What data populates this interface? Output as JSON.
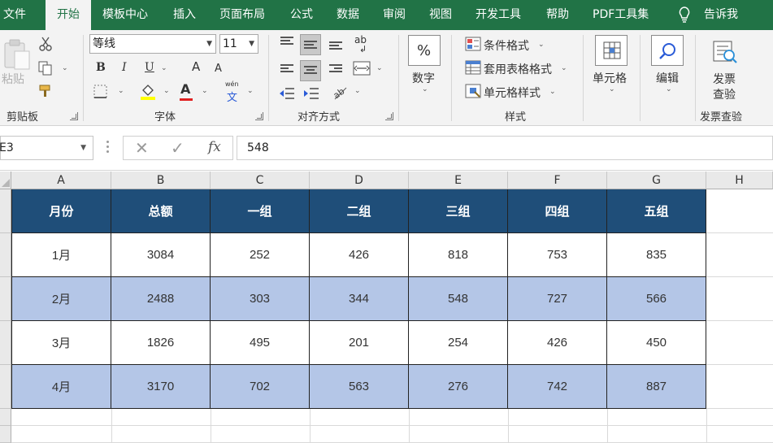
{
  "tabs": [
    {
      "label": "文件"
    },
    {
      "label": "开始"
    },
    {
      "label": "模板中心"
    },
    {
      "label": "插入"
    },
    {
      "label": "页面布局"
    },
    {
      "label": "公式"
    },
    {
      "label": "数据"
    },
    {
      "label": "审阅"
    },
    {
      "label": "视图"
    },
    {
      "label": "开发工具"
    },
    {
      "label": "帮助"
    },
    {
      "label": "PDF工具集"
    },
    {
      "label": "告诉我"
    }
  ],
  "ribbon": {
    "clipboard": {
      "paste_label": "粘贴",
      "group_label": "剪贴板"
    },
    "font": {
      "font_name": "等线",
      "font_size": "11",
      "bold": "B",
      "italic": "I",
      "underline": "U",
      "grow": "A",
      "shrink": "A",
      "font_color": "A",
      "phonetic": "wén",
      "phonetic_char": "文",
      "group_label": "字体"
    },
    "alignment": {
      "wrap_glyph": "ab",
      "group_label": "对齐方式"
    },
    "number": {
      "percent_glyph": "%",
      "label": "数字"
    },
    "styles": {
      "conditional": "条件格式",
      "table": "套用表格格式",
      "cell": "单元格样式",
      "group_label": "样式"
    },
    "cells": {
      "label": "单元格"
    },
    "editing": {
      "label": "编辑"
    },
    "invoice": {
      "button_line1": "发票",
      "button_line2": "查验",
      "group_label": "发票查验"
    }
  },
  "formula_bar": {
    "name_box": "E3",
    "fx": "fx",
    "value": "548"
  },
  "columns": [
    "A",
    "B",
    "C",
    "D",
    "E",
    "F",
    "G",
    "H"
  ],
  "table": {
    "headers": [
      "月份",
      "总额",
      "一组",
      "二组",
      "三组",
      "四组",
      "五组"
    ],
    "rows": [
      [
        "1月",
        "3084",
        "252",
        "426",
        "818",
        "753",
        "835"
      ],
      [
        "2月",
        "2488",
        "303",
        "344",
        "548",
        "727",
        "566"
      ],
      [
        "3月",
        "1826",
        "495",
        "201",
        "254",
        "426",
        "450"
      ],
      [
        "4月",
        "3170",
        "702",
        "563",
        "276",
        "742",
        "887"
      ]
    ]
  },
  "colors": {
    "brand_green": "#217346",
    "header_fill": "#1f4e79",
    "band_fill": "#b4c6e7"
  }
}
